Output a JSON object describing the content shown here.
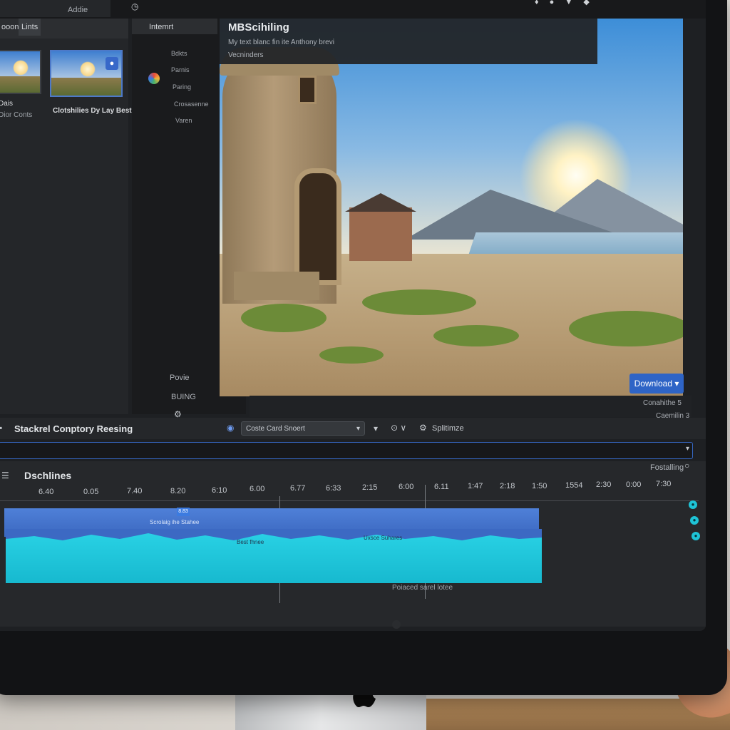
{
  "header": {
    "left_labels": [
      "ooon",
      "Lints",
      "Addie"
    ],
    "center_label": "Intemrt",
    "panel_title": "MBScihiling",
    "panel_sub_1": "My text blanc fin ite Anthony brevi",
    "panel_sub_2": "Vecninders"
  },
  "library": {
    "items": [
      {
        "caption": "Dais"
      },
      {
        "caption": "Clotshilies Dy Lay Bestiners"
      }
    ],
    "sub_caption": "Dior Conts"
  },
  "tree": {
    "items": [
      "Bdkts",
      "Parnis",
      "Paring",
      "Crosasenne",
      "Varen"
    ],
    "lower_items": [
      "Povie",
      "BUING"
    ]
  },
  "preview": {
    "download_label": "Download ▾",
    "side_label_1": "Conahithe 5",
    "side_label_2": "Caemilin 3"
  },
  "toolbar": {
    "title": "Stackrel Conptory Reesing",
    "select_value": "Coste Card Snoert",
    "right_label": "Splitimze"
  },
  "timeline": {
    "title": "Dschlines",
    "right_label": "Fostalling",
    "ticks": [
      "6.40",
      "0.05",
      "7.40",
      "8.20",
      "6:10",
      "6.00",
      "6.77",
      "6:33",
      "2:15",
      "6:00",
      "6.11",
      "1:47",
      "2:18",
      "1:50",
      "1554",
      "2:30",
      "0:00",
      "7:30"
    ],
    "playhead_label": "8.83",
    "clip_label_1": "Scrolaig ihe Stahee",
    "clip_label_2": "Best fhnee",
    "clip_label_3": "Uxsce Suhares",
    "bottom_caption": "Poiaced sarel lotee"
  },
  "colors": {
    "accent": "#2e64c6",
    "clip_blue": "#4f80d8",
    "clip_cyan": "#2ad3e6"
  }
}
